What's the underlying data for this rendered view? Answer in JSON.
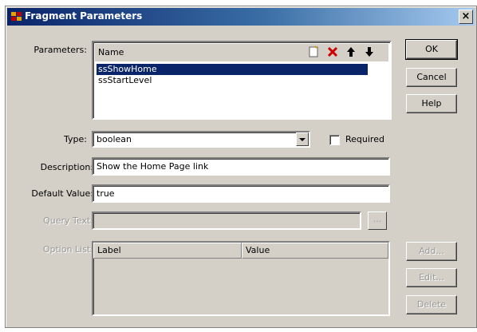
{
  "window": {
    "title": "Fragment Parameters",
    "close_glyph": "×"
  },
  "parameters": {
    "label": "Parameters:",
    "header": "Name",
    "items": [
      "ssShowHome",
      "ssStartLevel"
    ],
    "selected_index": 0,
    "icons": [
      "new-icon",
      "delete-icon",
      "move-up-icon",
      "move-down-icon"
    ]
  },
  "type": {
    "label": "Type:",
    "value": "boolean"
  },
  "required": {
    "label": "Required",
    "checked": false
  },
  "description": {
    "label": "Description:",
    "value": "Show the Home Page link"
  },
  "default_value": {
    "label": "Default Value:",
    "value": "true"
  },
  "query_text": {
    "label": "Query Text:",
    "value": "",
    "browse_label": "..."
  },
  "option_list": {
    "label": "Option List:",
    "columns": [
      "Label",
      "Value"
    ]
  },
  "buttons": {
    "ok": "OK",
    "cancel": "Cancel",
    "help": "Help",
    "add": "Add...",
    "edit": "Edit...",
    "delete": "Delete"
  },
  "colors": {
    "titlebar": "#0a246a",
    "dialog_bg": "#d4d0c8",
    "selection": "#0a246a",
    "delete_icon": "#cc0000"
  }
}
